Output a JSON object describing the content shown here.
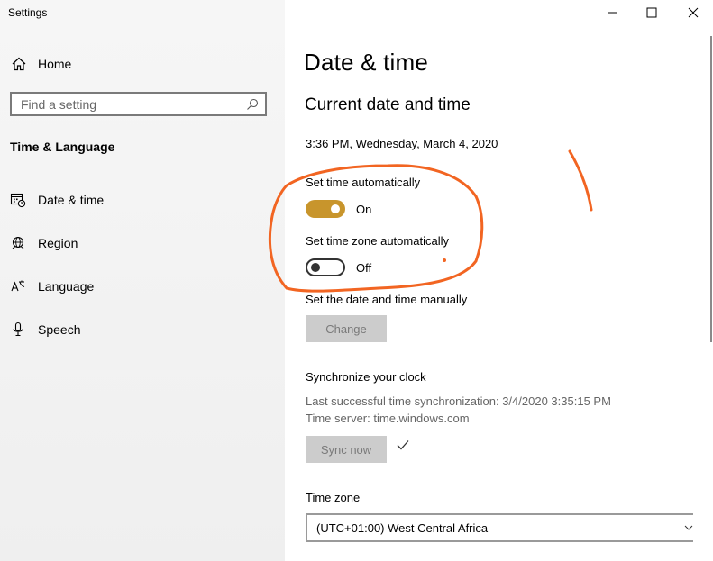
{
  "window": {
    "title": "Settings"
  },
  "sidebar": {
    "home_label": "Home",
    "search_placeholder": "Find a setting",
    "section_title": "Time & Language",
    "items": [
      {
        "label": "Date & time",
        "icon": "date-time-icon"
      },
      {
        "label": "Region",
        "icon": "globe-icon"
      },
      {
        "label": "Language",
        "icon": "language-icon"
      },
      {
        "label": "Speech",
        "icon": "microphone-icon"
      }
    ]
  },
  "main": {
    "page_title": "Date & time",
    "section_current": "Current date and time",
    "current_datetime": "3:36 PM, Wednesday, March 4, 2020",
    "set_time_auto_label": "Set time automatically",
    "set_time_auto_state": "On",
    "set_tz_auto_label": "Set time zone automatically",
    "set_tz_auto_state": "Off",
    "manual_label": "Set the date and time manually",
    "change_button": "Change",
    "sync_title": "Synchronize your clock",
    "last_sync": "Last successful time synchronization: 3/4/2020 3:35:15 PM",
    "time_server": "Time server: time.windows.com",
    "sync_button": "Sync now",
    "timezone_label": "Time zone",
    "timezone_value": "(UTC+01:00) West Central Africa"
  },
  "colors": {
    "toggle_on": "#c8952c",
    "annotation": "#f26522"
  }
}
